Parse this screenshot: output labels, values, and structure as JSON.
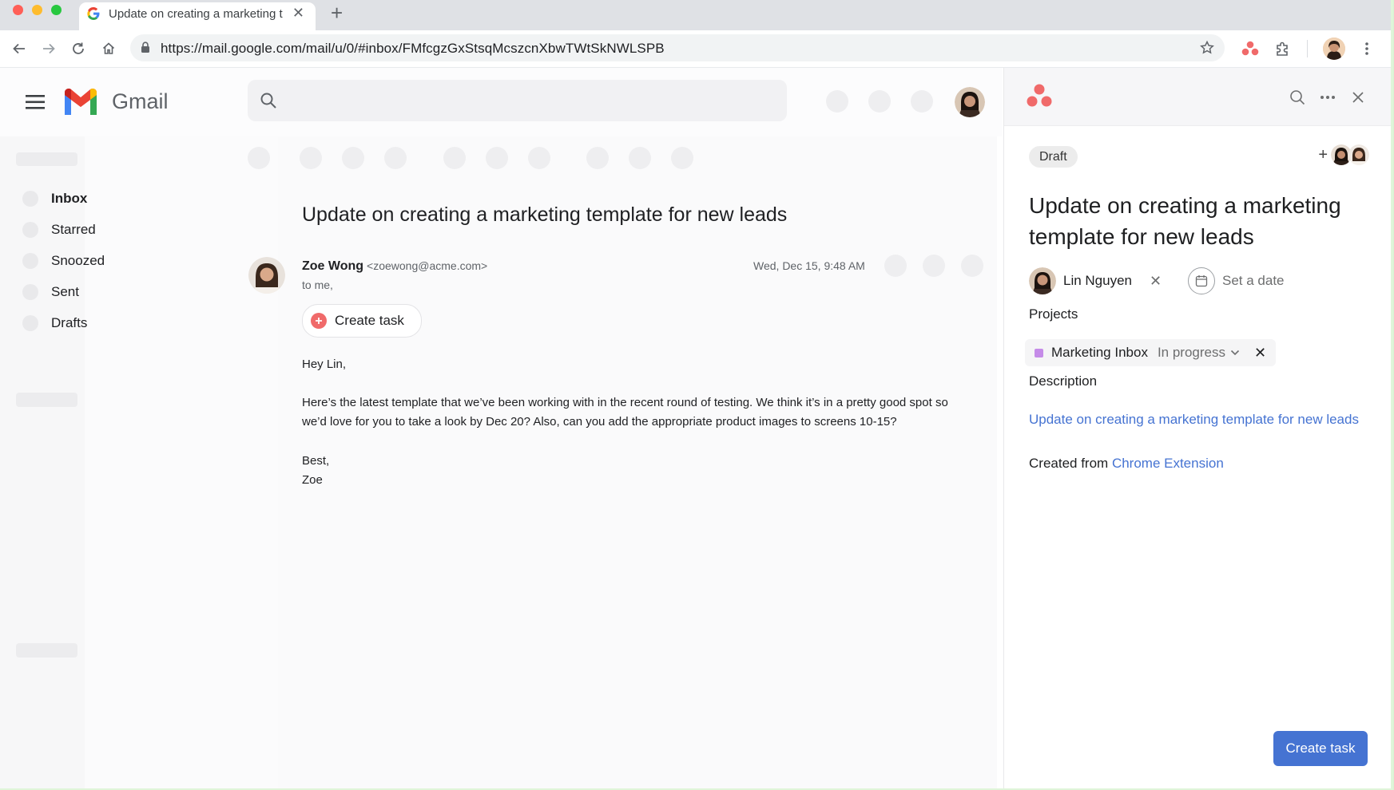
{
  "browser": {
    "tab_title": "Update on creating a marketing t",
    "url": "https://mail.google.com/mail/u/0/#inbox/FMfcgzGxStsqMcszcnXbwTWtSkNWLSPB"
  },
  "gmail": {
    "wordmark": "Gmail",
    "nav": [
      {
        "label": "Inbox",
        "active": true
      },
      {
        "label": "Starred"
      },
      {
        "label": "Snoozed"
      },
      {
        "label": "Sent"
      },
      {
        "label": "Drafts"
      }
    ],
    "email": {
      "subject": "Update on creating a marketing template for new leads",
      "sender_name": "Zoe Wong",
      "sender_email": "<zoewong@acme.com>",
      "recipient": "to me,",
      "date": "Wed, Dec 15, 9:48 AM",
      "create_task_label": "Create task",
      "greeting": "Hey Lin,",
      "body_line1": "Here’s the latest template that we’ve been working with in the recent round of testing. We think it’s in a pretty good spot so",
      "body_line2": "we’d love for you to take a look by Dec 20? Also, can you add the appropriate product images to screens 10-15?",
      "signoff": "Best,",
      "signature": "Zoe"
    }
  },
  "asana": {
    "status_badge": "Draft",
    "task_title": "Update on creating a marketing template for new leads",
    "assignee": "Lin Nguyen",
    "due_placeholder": "Set a date",
    "projects_label": "Projects",
    "project_name": "Marketing Inbox",
    "project_status": "In progress",
    "description_label": "Description",
    "description_link": "Update on creating a marketing template for new leads",
    "created_from_prefix": "Created from",
    "created_from_link": "Chrome Extension",
    "create_button": "Create task",
    "colors": {
      "accent": "#4573d2",
      "logo": "#f06a6a",
      "project": "#c58be8"
    }
  }
}
